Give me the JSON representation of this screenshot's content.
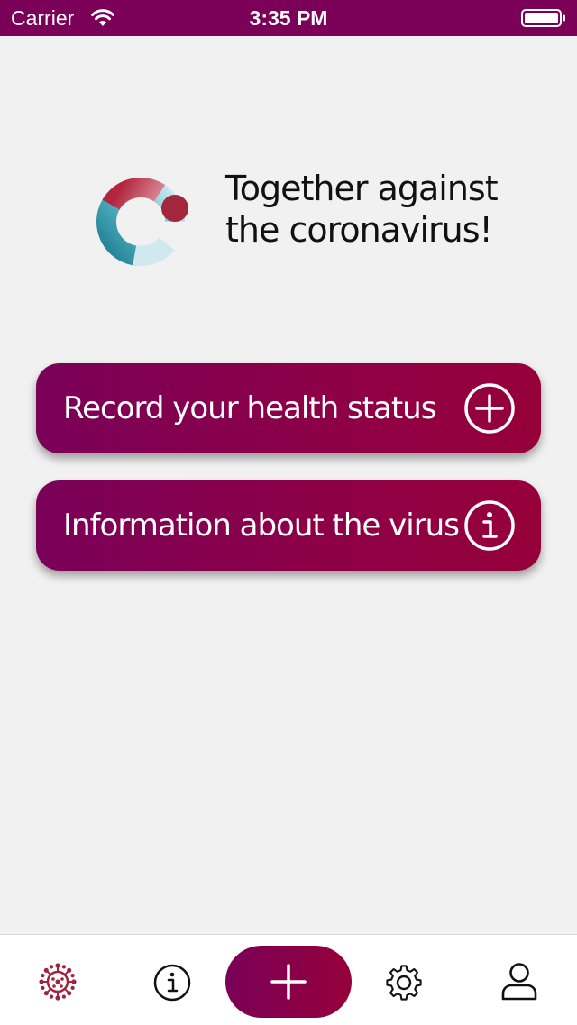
{
  "status_bar": {
    "carrier": "Carrier",
    "time": "3:35 PM",
    "background": "#7a0058"
  },
  "hero": {
    "logo_icon": "ring-logo-icon",
    "tagline_line1": "Together against",
    "tagline_line2": "the coronavirus!"
  },
  "actions": [
    {
      "label": "Record your health status",
      "icon": "plus-circle-icon"
    },
    {
      "label": "Information about the virus",
      "icon": "info-circle-icon"
    }
  ],
  "tab_bar": {
    "items": [
      {
        "icon": "virus-icon",
        "active": true
      },
      {
        "icon": "info-icon",
        "active": false
      },
      {
        "icon": "plus-icon",
        "active": false
      },
      {
        "icon": "gear-icon",
        "active": false
      },
      {
        "icon": "person-icon",
        "active": false
      }
    ]
  },
  "colors": {
    "accent_start": "#7a0058",
    "accent_end": "#96003a",
    "background": "#f1f1f1"
  }
}
